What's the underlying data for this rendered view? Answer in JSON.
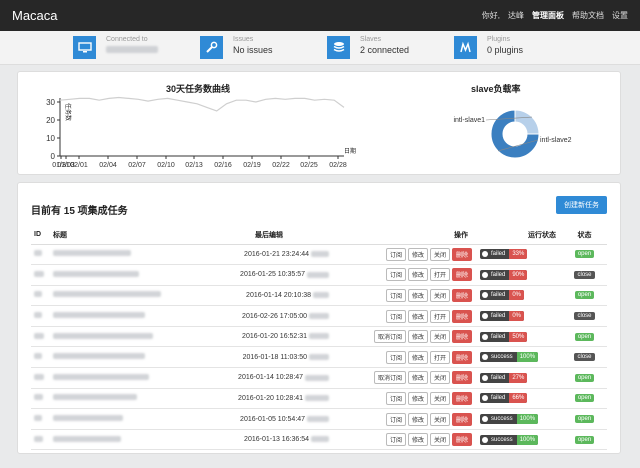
{
  "app": {
    "brand": "Macaca"
  },
  "nav": {
    "hello": "你好,",
    "user": "达峰",
    "admin": "管理面板",
    "help": "帮助文档",
    "settings": "设置"
  },
  "stats": [
    {
      "label": "Connected to",
      "value": "",
      "icon": "monitor-icon"
    },
    {
      "label": "Issues",
      "value": "No issues",
      "icon": "wrench-icon"
    },
    {
      "label": "Slaves",
      "value": "2 connected",
      "icon": "database-icon"
    },
    {
      "label": "Plugins",
      "value": "0 plugins",
      "icon": "plugin-icon"
    }
  ],
  "line_chart": {
    "title": "30天任务数曲线",
    "ylabel": "任务数",
    "xlabel": "日期"
  },
  "donut_chart": {
    "title": "slave负载率"
  },
  "chart_data": [
    {
      "type": "line",
      "title": "30天任务数曲线",
      "ylabel": "任务数",
      "xlabel": "日期",
      "ylim": [
        0,
        30
      ],
      "yticks": [
        0,
        10,
        20,
        30
      ],
      "xticks": [
        "01/31",
        "01/03",
        "02/01",
        "02/04",
        "02/07",
        "02/10",
        "02/13",
        "02/16",
        "02/19",
        "02/22",
        "02/25",
        "02/28"
      ],
      "color": "#cfcfcf",
      "y": [
        31,
        31.5,
        32,
        32,
        31,
        32,
        32.5,
        32,
        31.5,
        30.5,
        31.5,
        32,
        31,
        30,
        29,
        27,
        25,
        29,
        31,
        31,
        30,
        31.5,
        32,
        31.5,
        32,
        32,
        31,
        31.5,
        31,
        27
      ]
    },
    {
      "type": "pie",
      "title": "slave负载率",
      "labels": [
        "intl-slave1",
        "intl-slave2"
      ],
      "values": [
        25,
        75
      ],
      "colors": [
        "#b7d0ea",
        "#3b7fc0"
      ]
    }
  ],
  "list": {
    "title": "目前有 15 项集成任务",
    "create_label": "创建新任务",
    "headers": {
      "id": "ID",
      "title": "标题",
      "edited": "最后编辑",
      "ops": "操作",
      "run": "运行状态",
      "status": "状态"
    },
    "rows": [
      {
        "time": "2016-01-21 23:24:44",
        "ops": [
          "订阅",
          "修改",
          "关闭",
          "删除"
        ],
        "result": "failed",
        "pct": "33%",
        "state": "open"
      },
      {
        "time": "2016-01-25 10:35:57",
        "ops": [
          "订阅",
          "修改",
          "打开",
          "删除"
        ],
        "result": "failed",
        "pct": "90%",
        "state": "close"
      },
      {
        "time": "2016-01-14 20:10:38",
        "ops": [
          "订阅",
          "修改",
          "关闭",
          "删除"
        ],
        "result": "failed",
        "pct": "0%",
        "state": "open"
      },
      {
        "time": "2016-02-26 17:05:00",
        "ops": [
          "订阅",
          "修改",
          "打开",
          "删除"
        ],
        "result": "failed",
        "pct": "0%",
        "state": "close"
      },
      {
        "time": "2016-01-20 16:52:31",
        "ops": [
          "取消订阅",
          "修改",
          "关闭",
          "删除"
        ],
        "result": "failed",
        "pct": "50%",
        "state": "open"
      },
      {
        "time": "2016-01-18 11:03:50",
        "ops": [
          "订阅",
          "修改",
          "打开",
          "删除"
        ],
        "result": "success",
        "pct": "100%",
        "state": "close"
      },
      {
        "time": "2016-01-14 10:28:47",
        "ops": [
          "取消订阅",
          "修改",
          "关闭",
          "删除"
        ],
        "result": "failed",
        "pct": "27%",
        "state": "open"
      },
      {
        "time": "2016-01-20 10:28:41",
        "ops": [
          "订阅",
          "修改",
          "关闭",
          "删除"
        ],
        "result": "failed",
        "pct": "66%",
        "state": "open"
      },
      {
        "time": "2016-01-05 10:54:47",
        "ops": [
          "订阅",
          "修改",
          "关闭",
          "删除"
        ],
        "result": "success",
        "pct": "100%",
        "state": "open"
      },
      {
        "time": "2016-01-13 16:36:54",
        "ops": [
          "订阅",
          "修改",
          "关闭",
          "删除"
        ],
        "result": "success",
        "pct": "100%",
        "state": "open"
      }
    ]
  }
}
